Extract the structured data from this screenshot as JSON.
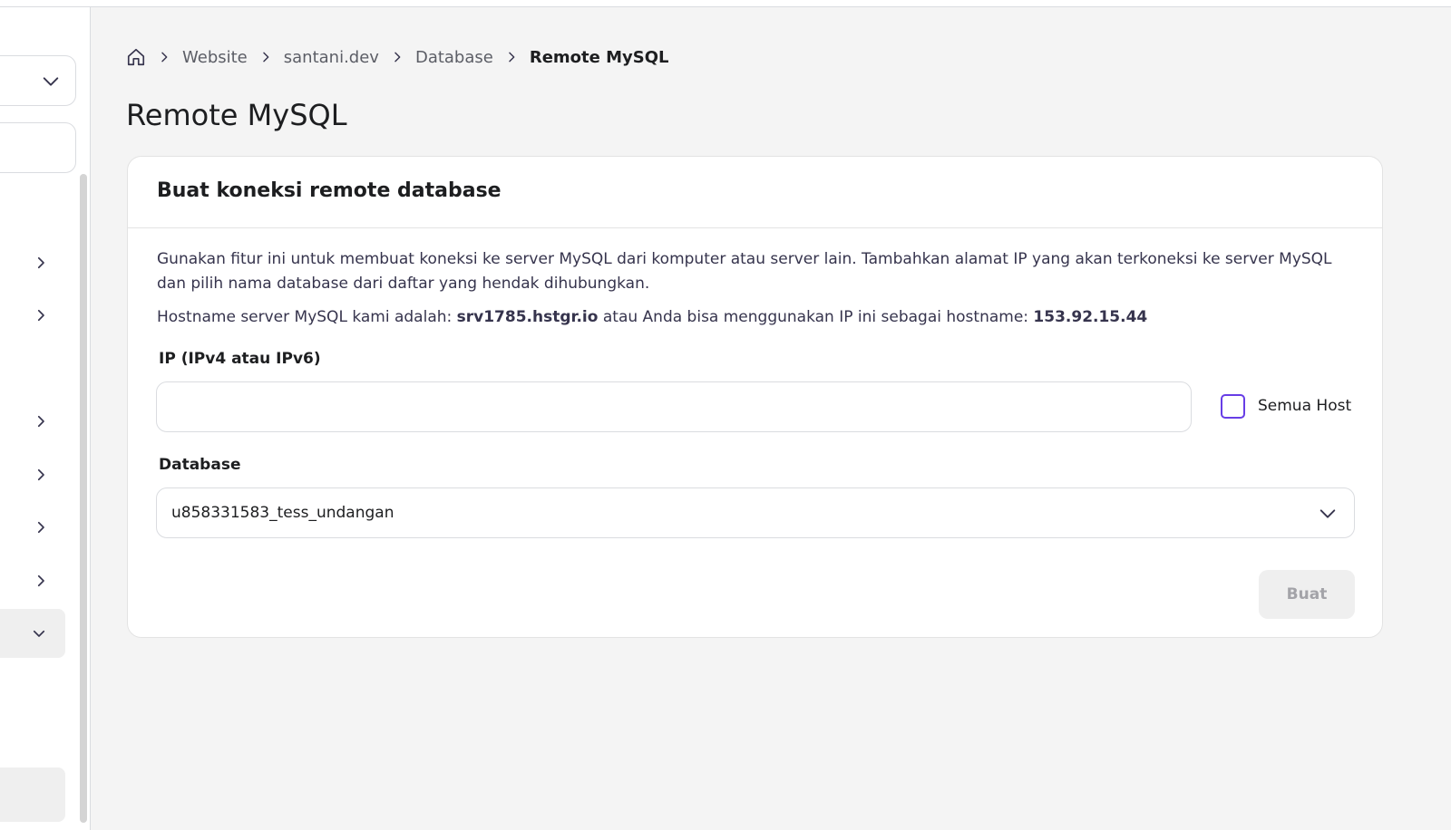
{
  "breadcrumb": {
    "items": [
      "Website",
      "santani.dev",
      "Database"
    ],
    "current": "Remote MySQL"
  },
  "page": {
    "title": "Remote MySQL"
  },
  "card": {
    "title": "Buat koneksi remote database",
    "description": "Gunakan fitur ini untuk membuat koneksi ke server MySQL dari komputer atau server lain. Tambahkan alamat IP yang akan terkoneksi ke server MySQL dan pilih nama database dari daftar yang hendak dihubungkan.",
    "hostname_prefix": "Hostname server MySQL kami adalah: ",
    "hostname": "srv1785.hstgr.io",
    "hostname_middle": " atau Anda bisa menggunakan IP ini sebagai hostname: ",
    "ip": "153.92.15.44"
  },
  "form": {
    "ip_label": "IP (IPv4 atau IPv6)",
    "ip_value": "",
    "all_hosts_label": "Semua Host",
    "all_hosts_checked": false,
    "database_label": "Database",
    "database_selected": "u858331583_tess_undangan",
    "submit_label": "Buat"
  },
  "colors": {
    "accent": "#673de6",
    "background": "#f4f4f4",
    "card": "#ffffff"
  },
  "icons": {
    "home": "home-icon",
    "separator": "chevron-right-icon",
    "dropdown": "chevron-down-icon"
  }
}
